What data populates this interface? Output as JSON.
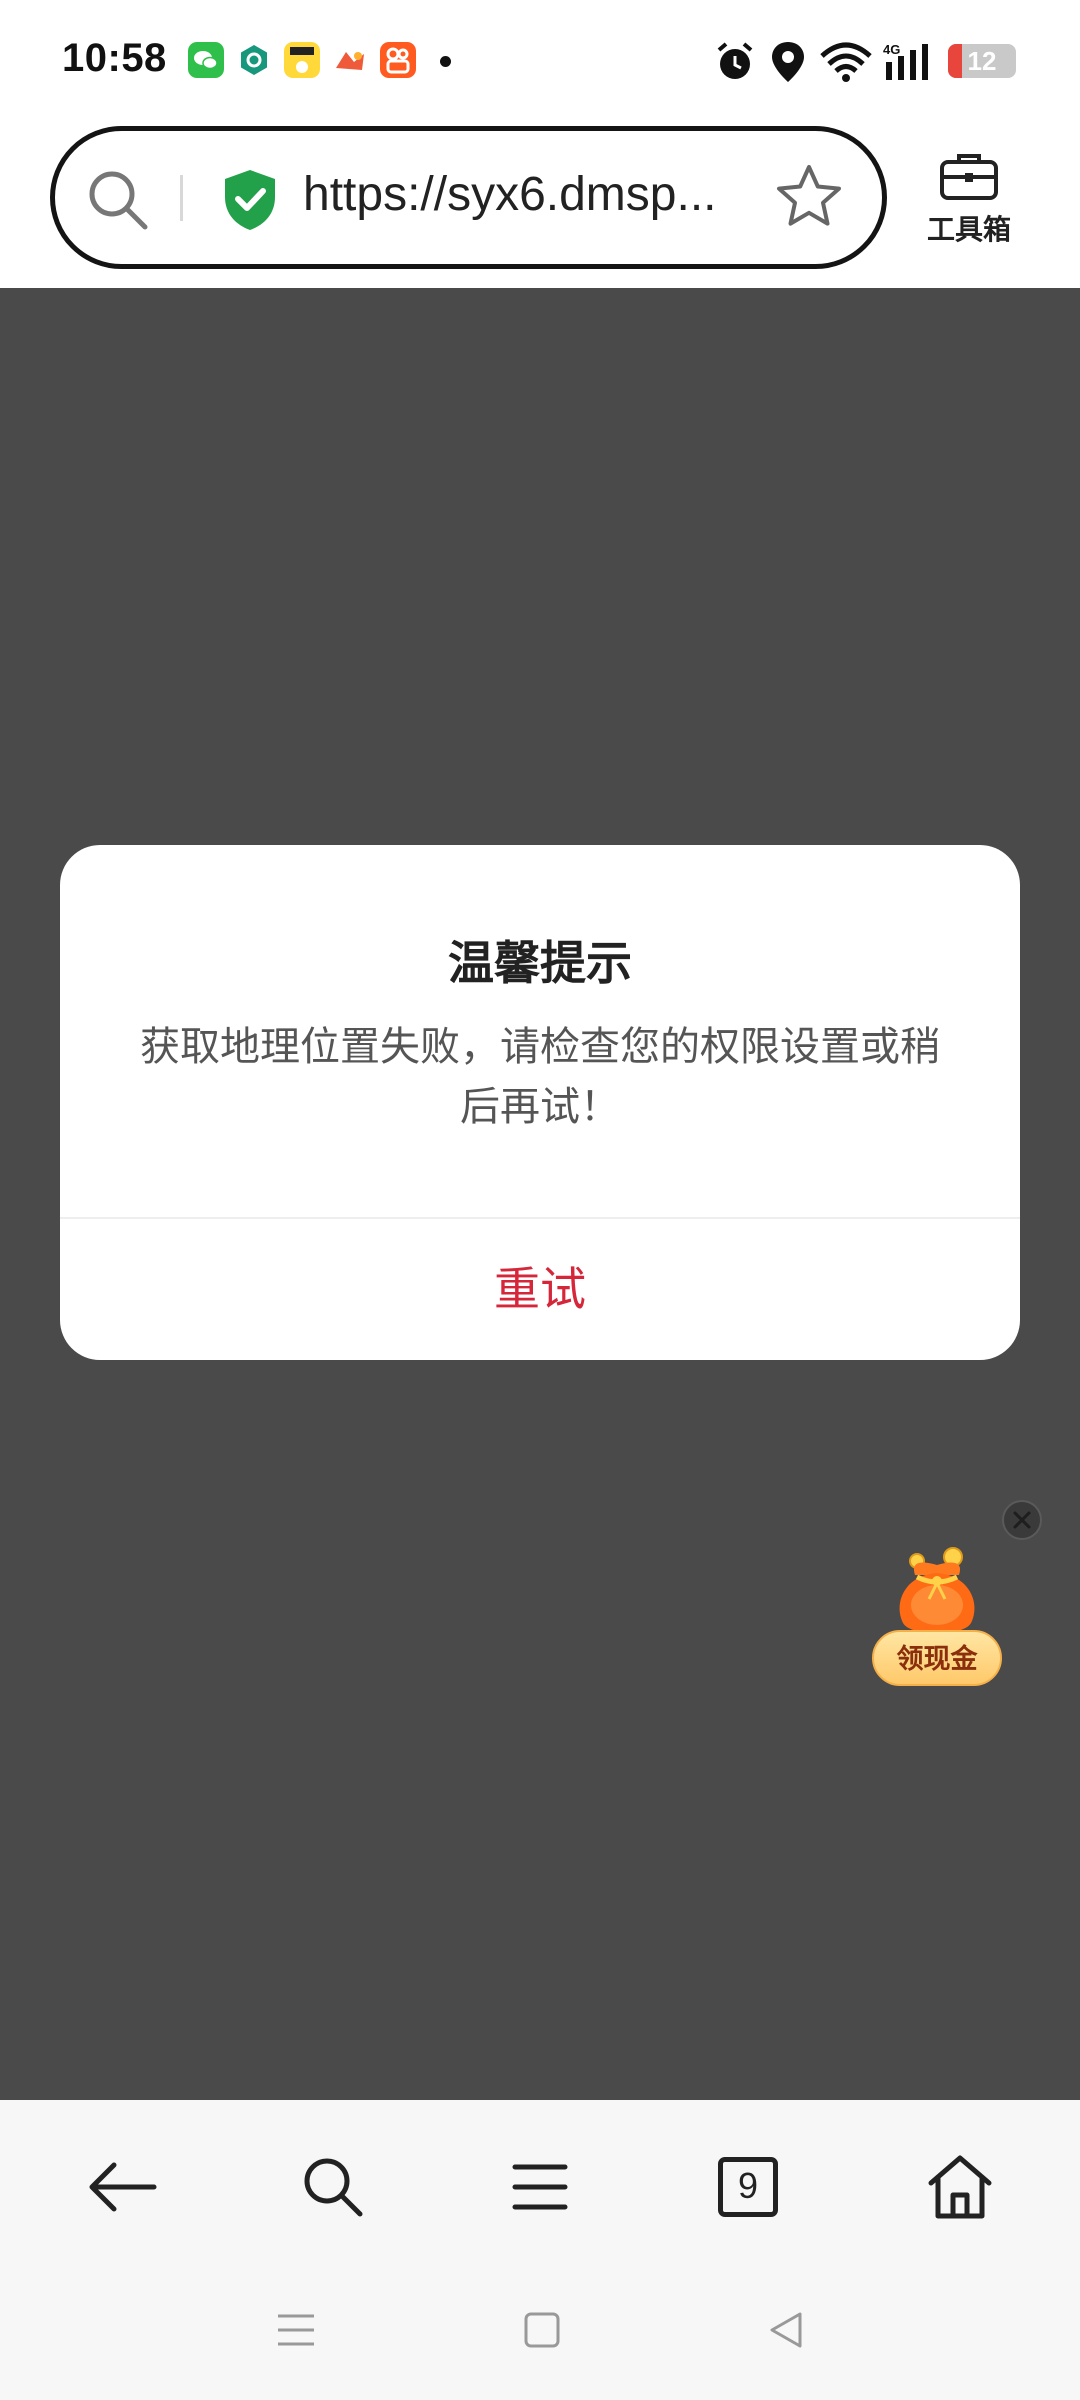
{
  "status_bar": {
    "time": "10:58",
    "notification_icons": [
      "wechat-icon",
      "app-hexagon-icon",
      "app-yellow-icon",
      "app-game-icon",
      "kuaishou-icon"
    ],
    "network_label": "4G",
    "battery_level": "12"
  },
  "address_bar": {
    "url": "https://syx6.dmsp...",
    "toolbox_label": "工具箱"
  },
  "dialog": {
    "title": "温馨提示",
    "message": "获取地理位置失败，请检查您的权限设置或稍后再试！",
    "button_label": "重试"
  },
  "reward": {
    "label": "领现金"
  },
  "bottom_nav": {
    "tabs_count": "9",
    "items": [
      "back-icon",
      "search-icon",
      "menu-icon",
      "tabs-icon",
      "home-icon"
    ]
  },
  "colors": {
    "accent_red": "#d5263a",
    "overlay": "#4a4a4a",
    "shield_green": "#23a04a"
  }
}
